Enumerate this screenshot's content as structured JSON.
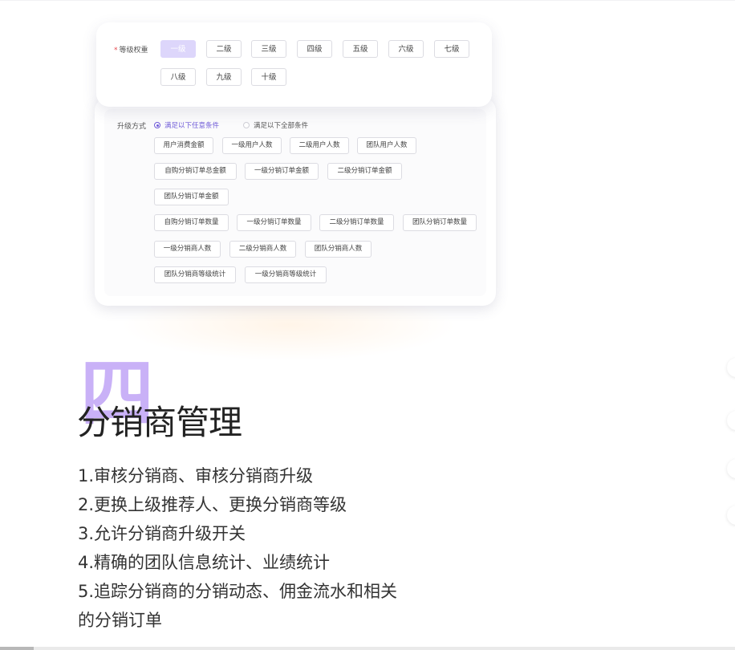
{
  "level_card": {
    "label": "等级权重",
    "required_mark": "*",
    "levels": [
      "一级",
      "二级",
      "三级",
      "四级",
      "五级",
      "六级",
      "七级",
      "八级",
      "九级",
      "十级"
    ],
    "selected": "一级"
  },
  "upgrade_card": {
    "label": "升级方式",
    "options": [
      {
        "label": "满足以下任意条件",
        "selected": true
      },
      {
        "label": "满足以下全部条件",
        "selected": false
      }
    ],
    "conditions": [
      [
        "用户消费金额",
        "一级用户人数",
        "二级用户人数",
        "团队用户人数"
      ],
      [
        "自购分销订单总金额",
        "一级分销订单金额",
        "二级分销订单金额"
      ],
      [
        "团队分销订单金额"
      ],
      [
        "自购分销订单数量",
        "一级分销订单数量",
        "二级分销订单数量",
        "团队分销订单数量"
      ],
      [
        "一级分销商人数",
        "二级分销商人数",
        "团队分销商人数"
      ],
      [
        "团队分销商等级统计",
        "一级分销商等级统计"
      ]
    ]
  },
  "section": {
    "numeral": "四",
    "title": "分销商管理",
    "features": [
      "1.审核分销商、审核分销商升级",
      "2.更换上级推荐人、更换分销商等级",
      "3.允许分销商升级开关",
      "4.精确的团队信息统计、业绩统计",
      "5.追踪分销商的分销动态、佣金流水和相关",
      "的分销订单"
    ]
  },
  "colors": {
    "accent": "#6f5bd8",
    "selected_level_bg": "#ddd6fb",
    "numeral": "#c9b1f7",
    "heading": "#222222"
  }
}
